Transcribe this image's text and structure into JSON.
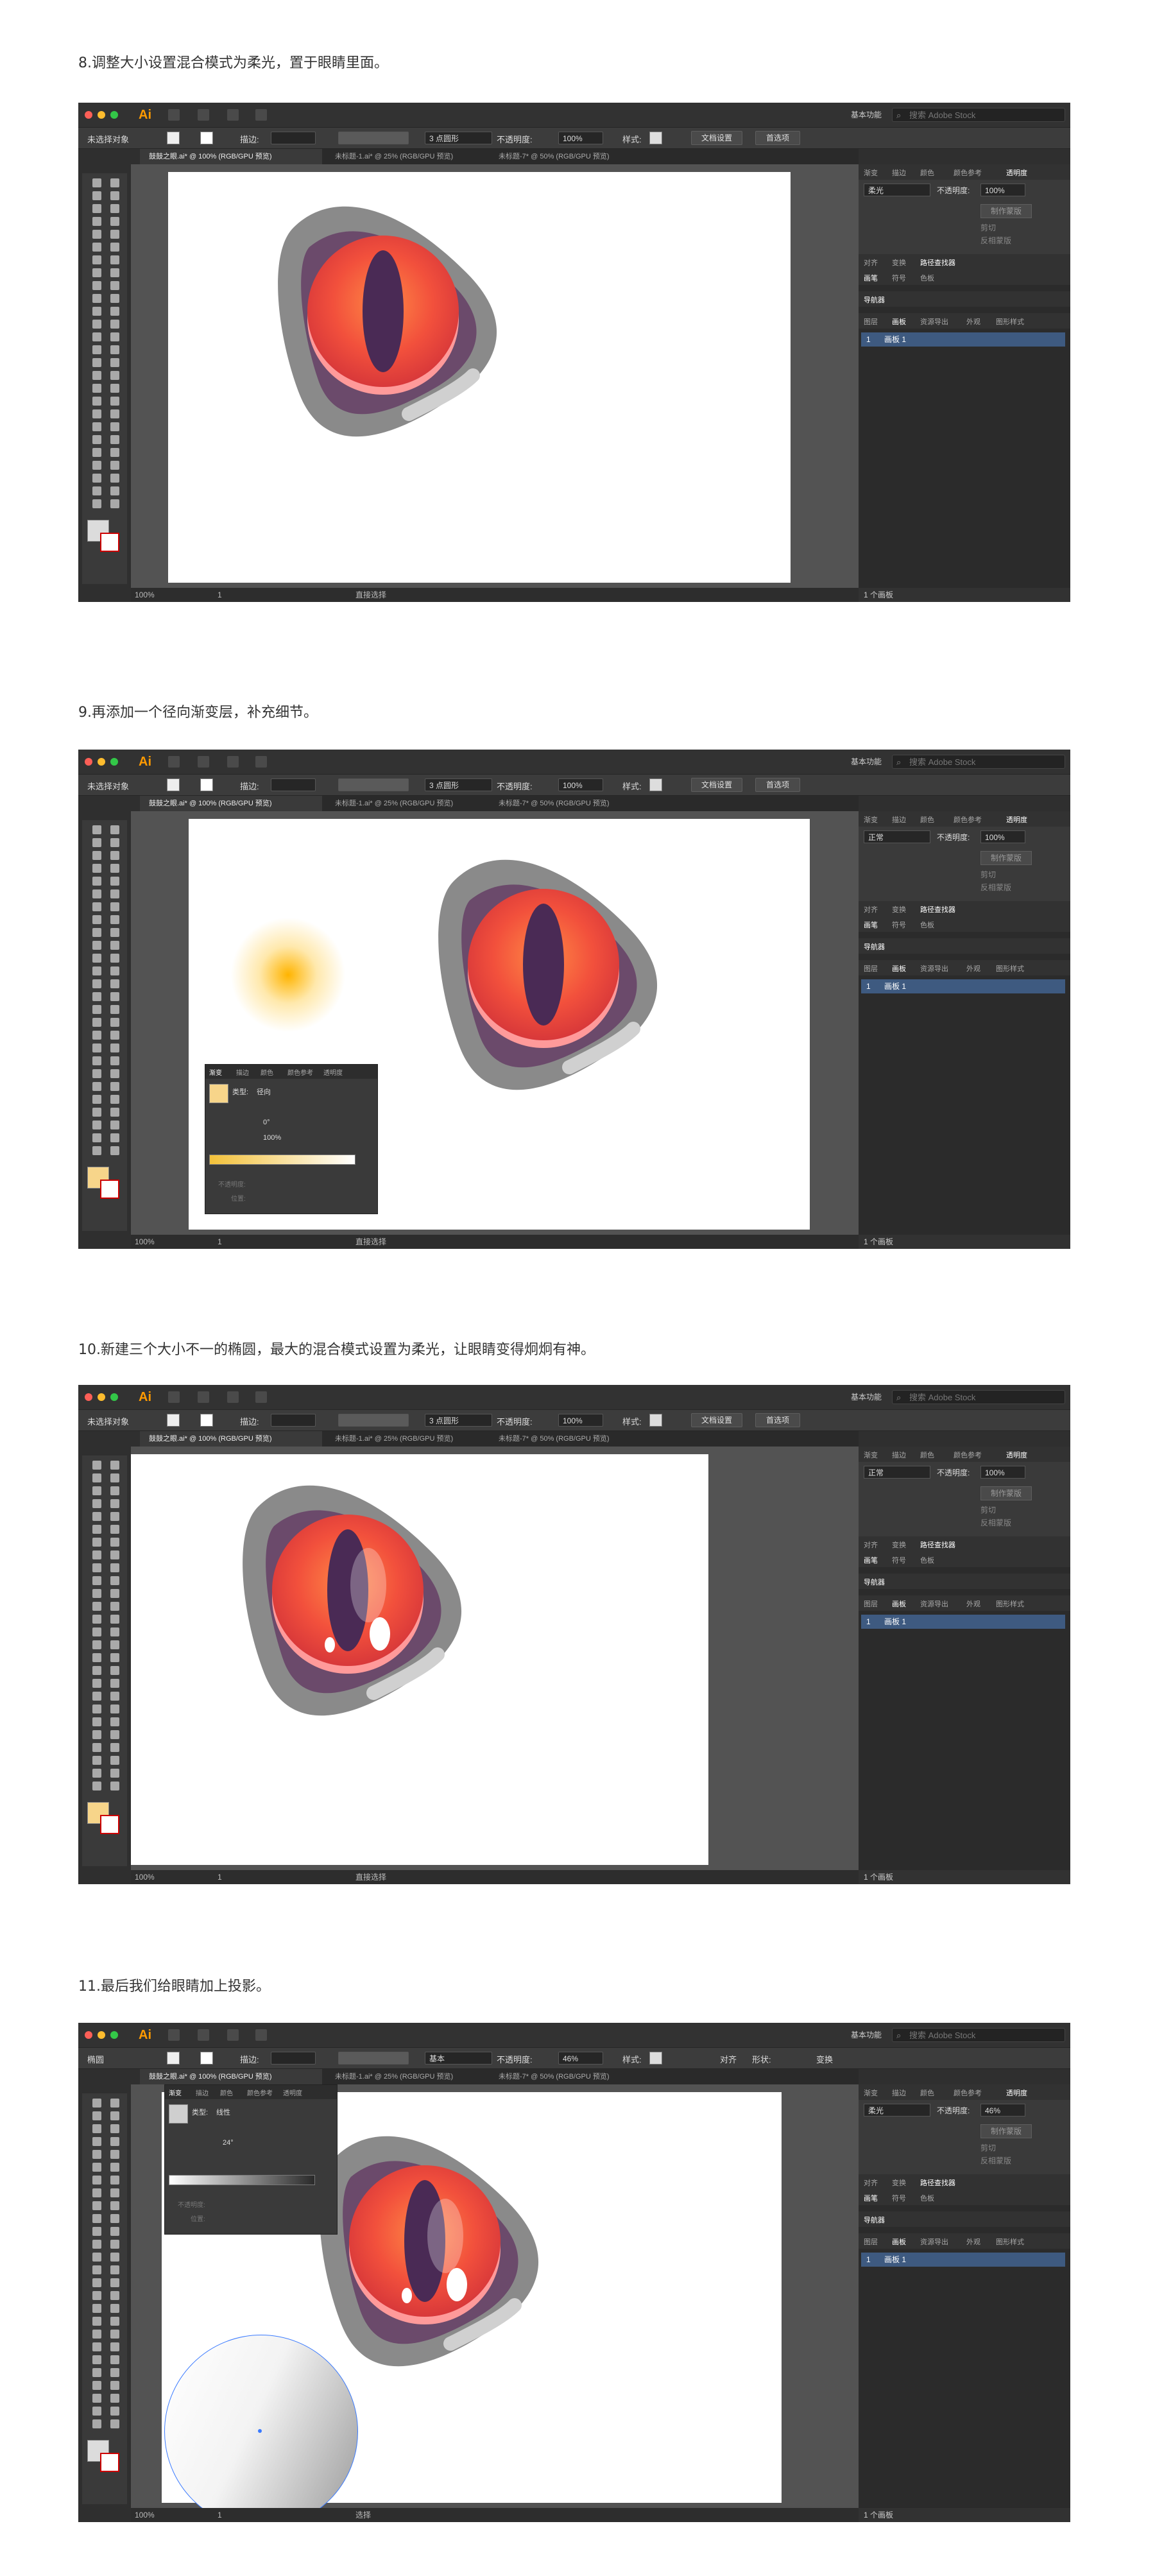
{
  "steps": [
    {
      "caption": "8.调整大小设置混合模式为柔光，置于眼睛里面。",
      "control": {
        "selection": "未选择对象",
        "stroke_label": "描边:",
        "brush": "3 点圆形",
        "opacity_label": "不透明度:",
        "opacity": "100%",
        "style_label": "样式:",
        "doc_setup": "文档设置",
        "prefs": "首选项"
      },
      "transparency": {
        "mode": "柔光",
        "opacity_label": "不透明度:",
        "opacity": "100%",
        "make_mask": "制作蒙版",
        "clip": "剪切",
        "invert": "反相蒙版"
      },
      "status": {
        "zoom": "100%",
        "page": "1",
        "tool": "直接选择"
      }
    },
    {
      "caption": "9.再添加一个径向渐变层，补充细节。",
      "control": {
        "selection": "未选择对象",
        "stroke_label": "描边:",
        "brush": "3 点圆形",
        "opacity_label": "不透明度:",
        "opacity": "100%",
        "style_label": "样式:",
        "doc_setup": "文档设置",
        "prefs": "首选项"
      },
      "transparency": {
        "mode": "正常",
        "opacity_label": "不透明度:",
        "opacity": "100%",
        "make_mask": "制作蒙版",
        "clip": "剪切",
        "invert": "反相蒙版"
      },
      "gradient_panel": {
        "type_label": "类型:",
        "type": "径向",
        "angle": "0°",
        "scale": "100%",
        "opacity_label": "不透明度:",
        "position_label": "位置:"
      },
      "status": {
        "zoom": "100%",
        "page": "1",
        "tool": "直接选择"
      }
    },
    {
      "caption": "10.新建三个大小不一的椭圆，最大的混合模式设置为柔光，让眼睛变得炯炯有神。",
      "control": {
        "selection": "未选择对象",
        "stroke_label": "描边:",
        "brush": "3 点圆形",
        "opacity_label": "不透明度:",
        "opacity": "100%",
        "style_label": "样式:",
        "doc_setup": "文档设置",
        "prefs": "首选项"
      },
      "transparency": {
        "mode": "正常",
        "opacity_label": "不透明度:",
        "opacity": "100%",
        "make_mask": "制作蒙版",
        "clip": "剪切",
        "invert": "反相蒙版"
      },
      "status": {
        "zoom": "100%",
        "page": "1",
        "tool": "直接选择"
      }
    },
    {
      "caption": "11.最后我们给眼睛加上投影。",
      "control": {
        "selection": "椭圆",
        "stroke_label": "描边:",
        "brush": "基本",
        "opacity_label": "不透明度:",
        "opacity": "46%",
        "style_label": "样式:",
        "align": "对齐",
        "shape": "形状:",
        "transform": "变换"
      },
      "transparency": {
        "mode": "柔光",
        "opacity_label": "不透明度:",
        "opacity": "46%",
        "make_mask": "制作蒙版",
        "clip": "剪切",
        "invert": "反相蒙版"
      },
      "gradient_panel": {
        "type_label": "类型:",
        "type": "线性",
        "angle": "24°",
        "opacity_label": "不透明度:",
        "position_label": "位置:"
      },
      "status": {
        "zoom": "100%",
        "page": "1",
        "tool": "选择"
      }
    }
  ],
  "app": {
    "logo": "Ai",
    "workspace": "基本功能",
    "search_placeholder": "搜索 Adobe Stock",
    "tabs": [
      "鼓鼓之眼.ai* @ 100% (RGB/GPU 预览)",
      "未标题-1.ai* @ 25% (RGB/GPU 预览)",
      "未标题-7* @ 50% (RGB/GPU 预览)"
    ],
    "panel_tabs_top": [
      "渐变",
      "描边",
      "颜色",
      "颜色参考",
      "透明度"
    ],
    "panel_tabs_mid": [
      "对齐",
      "变换",
      "路径查找器"
    ],
    "panel_tabs_lib": [
      "画笔",
      "符号",
      "色板"
    ],
    "panel_nav": "导航器",
    "panel_tabs_layers": [
      "图层",
      "画板",
      "资源导出",
      "外观",
      "图形样式"
    ],
    "artboard_row": {
      "index": "1",
      "name": "画板 1"
    },
    "artboard_count": "1 个画板",
    "gradient_tabs": [
      "渐变",
      "描边",
      "颜色",
      "颜色参考",
      "透明度"
    ]
  },
  "colors": {
    "accent": "#ff9a00",
    "eye_red": "#f04a3c",
    "iris_orange": "#ff7a3a",
    "pupil": "#4a2a55",
    "outer_ring": "#8a8a8a",
    "mid_ring": "#6b4a6b",
    "selection_blue": "#3e5a80"
  }
}
